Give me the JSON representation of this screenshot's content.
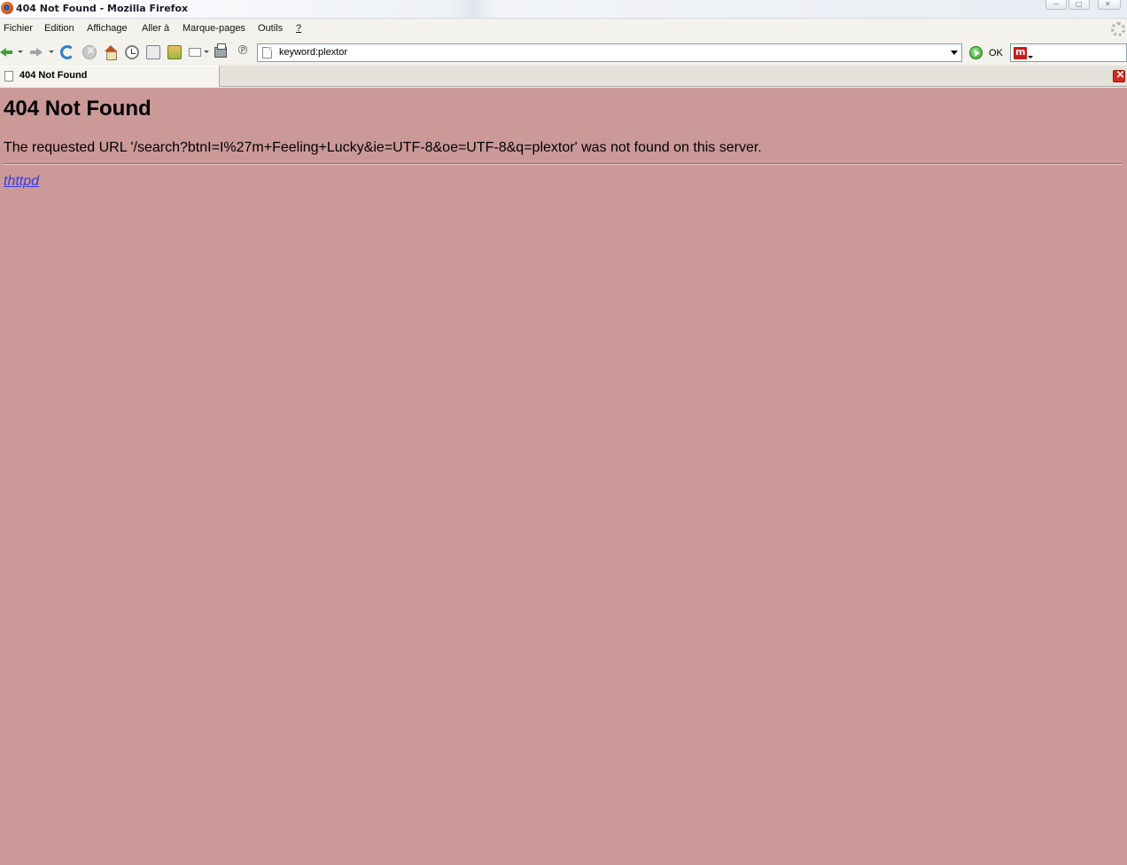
{
  "window": {
    "title": "404 Not Found - Mozilla Firefox",
    "controls": {
      "minimize": "—",
      "maximize": "□",
      "close": "✕"
    }
  },
  "menu": [
    {
      "label": "Fichier"
    },
    {
      "label": "Edition"
    },
    {
      "label": "Affichage"
    },
    {
      "label": "Aller à"
    },
    {
      "label": "Marque-pages"
    },
    {
      "label": "Outils"
    },
    {
      "label": "?"
    }
  ],
  "toolbar": {
    "icons": [
      "back-icon",
      "forward-icon",
      "reload-icon",
      "stop-icon",
      "home-icon",
      "history-icon",
      "bookmarks-icon",
      "download-icon",
      "mail-icon",
      "print-icon",
      "sign-icon"
    ],
    "url": "keyword:plextor",
    "go_label": "OK",
    "search_engine_glyph": "m",
    "search_value": ""
  },
  "tabs": [
    {
      "label": "404 Not Found",
      "active": true
    }
  ],
  "page": {
    "heading": "404 Not Found",
    "message": "The requested URL '/search?btnI=I%27m+Feeling+Lucky&ie=UTF-8&oe=UTF-8&q=plextor' was not found on this server.",
    "server_link": "thttpd",
    "background_color": "#cc9999",
    "link_color": "#3b3bdd"
  }
}
